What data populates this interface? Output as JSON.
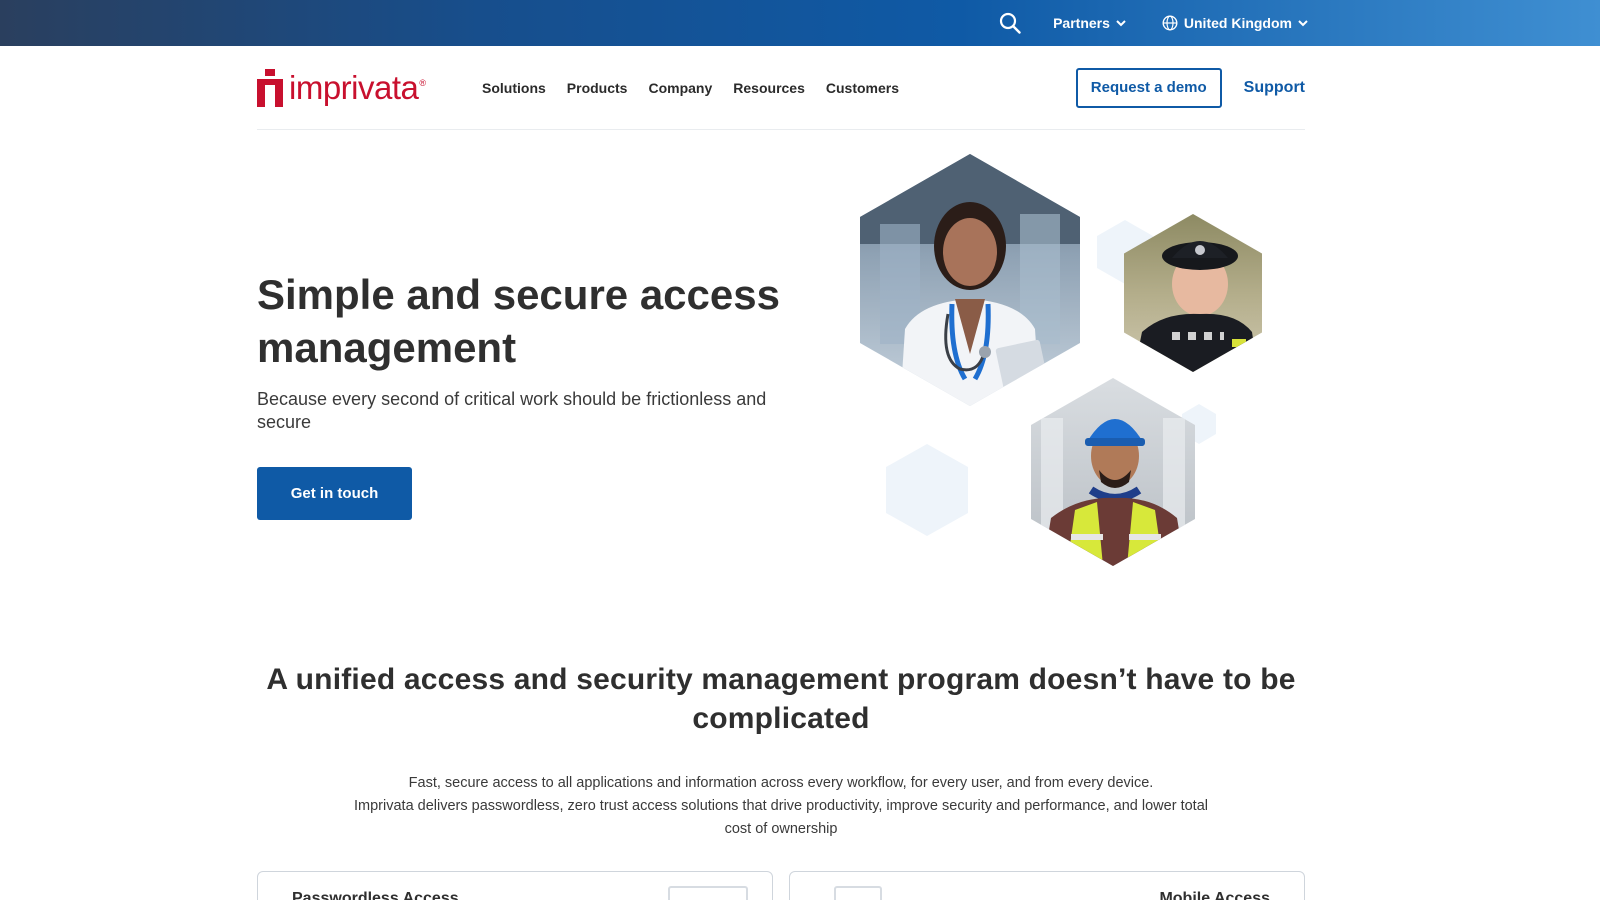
{
  "topbar": {
    "partners_label": "Partners",
    "region_label": "United Kingdom"
  },
  "nav": {
    "logo_text": "imprivata",
    "logo_tm": "®",
    "links": [
      "Solutions",
      "Products",
      "Company",
      "Resources",
      "Customers"
    ],
    "demo_label": "Request a demo",
    "support_label": "Support"
  },
  "hero": {
    "title": "Simple and secure access management",
    "subtitle": "Because every second of critical work should be frictionless and secure",
    "cta_label": "Get in touch"
  },
  "section": {
    "heading": "A unified access and security management program doesn’t have to be complicated",
    "body_line1": "Fast, secure access to all applications and information across every workflow, for every user, and from every device.",
    "body_line2": "Imprivata delivers passwordless, zero trust access solutions that drive productivity, improve security and performance, and lower total cost of ownership"
  },
  "cards": [
    {
      "title": "Passwordless Access"
    },
    {
      "title": "Mobile Access"
    }
  ],
  "colors": {
    "brand_red": "#c8102e",
    "brand_blue": "#0f5aa6"
  },
  "icons": [
    "search-icon",
    "chevron-down-icon",
    "globe-icon"
  ]
}
